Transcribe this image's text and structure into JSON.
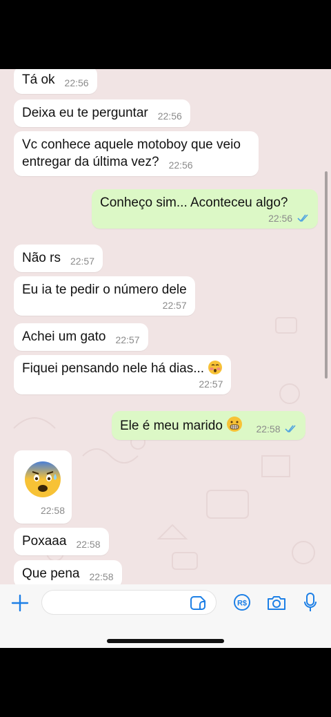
{
  "messages": [
    {
      "text": "Tá ok",
      "time": "22:56"
    },
    {
      "text": "Deixa eu te perguntar",
      "time": "22:56"
    },
    {
      "text": "Vc conhece aquele motoboy que veio entregar da última vez?",
      "time": "22:56"
    },
    {
      "text": "Conheço sim... Aconteceu algo?",
      "time": "22:56"
    },
    {
      "text": "Não rs",
      "time": "22:57"
    },
    {
      "text": "Eu ia te pedir o número dele",
      "time": "22:57"
    },
    {
      "text": "Achei um gato",
      "time": "22:57"
    },
    {
      "text": "Fiquei pensando nele há dias...",
      "time": "22:57"
    },
    {
      "text": "Ele é meu marido",
      "time": "22:58"
    },
    {
      "time": "22:58"
    },
    {
      "text": "Poxaaa",
      "time": "22:58"
    },
    {
      "text": "Que pena",
      "time": "22:58"
    }
  ],
  "icons": {
    "attach": "plus-icon",
    "sticker": "sticker-icon",
    "payment": "pix-payment-icon",
    "camera": "camera-icon",
    "mic": "microphone-icon",
    "read_receipt": "double-check-icon"
  },
  "colors": {
    "wallpaper": "#f1e4e4",
    "incoming_bubble": "#ffffff",
    "outgoing_bubble": "#dcf8c6",
    "accent": "#1c7fe6",
    "read_check": "#4fa3e0"
  }
}
